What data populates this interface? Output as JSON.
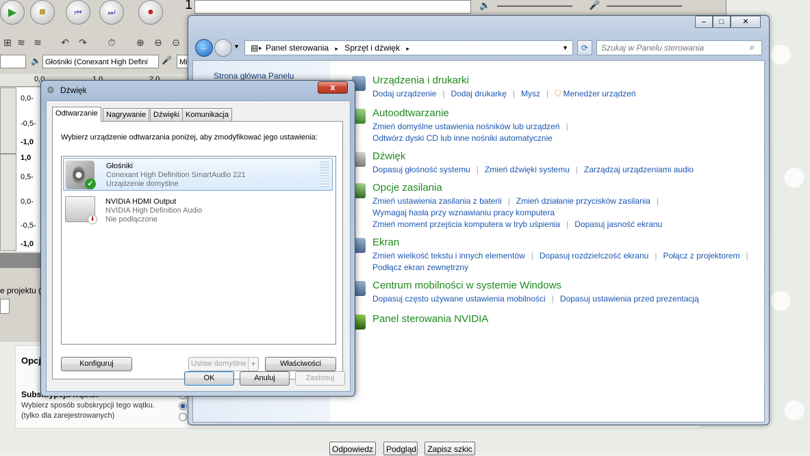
{
  "forum": {
    "section_opcje": "Opcj",
    "subscription_title": "Subskrypcja wątku:",
    "subscription_desc_1": "Wybierz sposób subskrypcji tego wątku.",
    "subscription_desc_2": "(tylko dla zarejestrowanych)",
    "btn_reply": "Odpowiedz",
    "btn_preview": "Podgląd",
    "btn_save_draft": "Zapisz szkic"
  },
  "audacity": {
    "output_device": "Głośniki (Conexant High Defini",
    "mic_label": "Mik",
    "ruler_0": "0,0",
    "ruler_1": "1,0",
    "ruler_2": "2,0",
    "scale_top": [
      "0,0-",
      "-0,5-",
      "-1,0",
      "1,0",
      "0,5-",
      "0,0-",
      "-0,5-",
      "-1,0"
    ],
    "project_rate_label": "e projektu (",
    "time_digit": "1"
  },
  "control_panel": {
    "breadcrumb": [
      "Panel sterowania",
      "Sprzęt i dźwięk"
    ],
    "search_placeholder": "Szukaj w Panelu sterowania",
    "left_link": "Strona główna Panelu",
    "categories": [
      {
        "title": "Urządzenia i drukarki",
        "lines": [
          [
            "Dodaj urządzenie",
            "Dodaj drukarkę",
            "Mysz",
            "Menedżer urządzeń"
          ]
        ]
      },
      {
        "title": "Autoodtwarzanie",
        "lines": [
          [
            "Zmień domyślne ustawienia nośników lub urządzeń"
          ],
          [
            "Odtwórz dyski CD lub inne nośniki automatycznie"
          ]
        ]
      },
      {
        "title": "Dźwięk",
        "lines": [
          [
            "Dopasuj głośność systemu",
            "Zmień dźwięki systemu",
            "Zarządzaj urządzeniami audio"
          ]
        ]
      },
      {
        "title": "Opcje zasilania",
        "lines": [
          [
            "Zmień ustawienia zasilania z baterii",
            "Zmień działanie przycisków zasilania"
          ],
          [
            "Wymagaj hasła przy wznawianiu pracy komputera"
          ],
          [
            "Zmień moment przejścia komputera w tryb uśpienia",
            "Dopasuj jasność ekranu"
          ]
        ]
      },
      {
        "title": "Ekran",
        "lines": [
          [
            "Zmień wielkość tekstu i innych elementów",
            "Dopasuj rozdzielczość ekranu",
            "Połącz z projektorem"
          ],
          [
            "Podłącz ekran zewnętrzny"
          ]
        ]
      },
      {
        "title": "Centrum mobilności w systemie Windows",
        "lines": [
          [
            "Dopasuj często używane ustawienia mobilności",
            "Dopasuj ustawienia przed prezentacją"
          ]
        ]
      },
      {
        "title": "Panel sterowania NVIDIA",
        "lines": []
      }
    ]
  },
  "sound_dialog": {
    "title": "Dźwięk",
    "tabs": [
      "Odtwarzanie",
      "Nagrywanie",
      "Dźwięki",
      "Komunikacja"
    ],
    "instruction": "Wybierz urządzenie odtwarzania poniżej, aby zmodyfikować jego ustawienia:",
    "devices": [
      {
        "name": "Głośniki",
        "driver": "Conexant High Definition SmartAudio 221",
        "status": "Urządzenie domyślne"
      },
      {
        "name": "NVIDIA HDMI Output",
        "driver": "NVIDIA High Definition Audio",
        "status": "Nie podłączone"
      }
    ],
    "btn_configure": "Konfiguruj",
    "btn_set_default": "Ustaw domyślne",
    "btn_properties": "Właściwości",
    "btn_ok": "OK",
    "btn_cancel": "Anuluj",
    "btn_apply": "Zastosuj",
    "close_glyph": "x"
  }
}
